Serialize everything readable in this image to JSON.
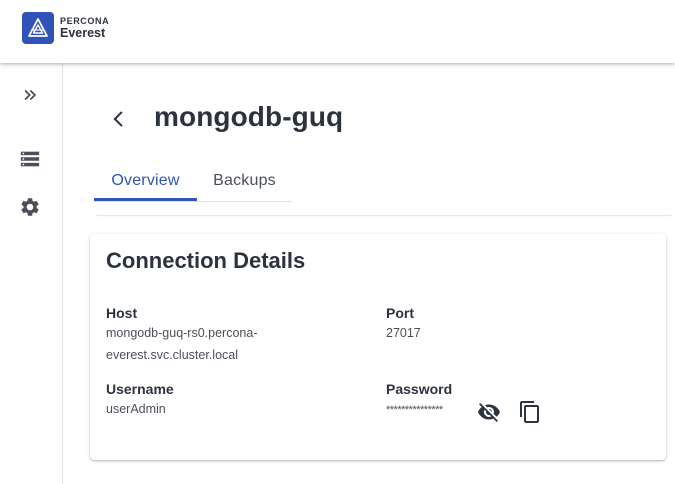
{
  "brand": {
    "top": "PERCONA",
    "bottom": "Everest",
    "color": "#2f53b8"
  },
  "sidebar": {
    "items": [
      {
        "icon": "double-chevron-right-icon"
      },
      {
        "icon": "database-list-icon"
      },
      {
        "icon": "gear-icon"
      }
    ]
  },
  "page": {
    "title": "mongodb-guq",
    "tabs": [
      {
        "label": "Overview",
        "active": true
      },
      {
        "label": "Backups",
        "active": false
      }
    ]
  },
  "connection": {
    "title": "Connection Details",
    "host_label": "Host",
    "host_value": "mongodb-guq-rs0.percona-everest.svc.cluster.local",
    "port_label": "Port",
    "port_value": "27017",
    "username_label": "Username",
    "username_value": "userAdmin",
    "password_label": "Password",
    "password_value": "***************"
  }
}
